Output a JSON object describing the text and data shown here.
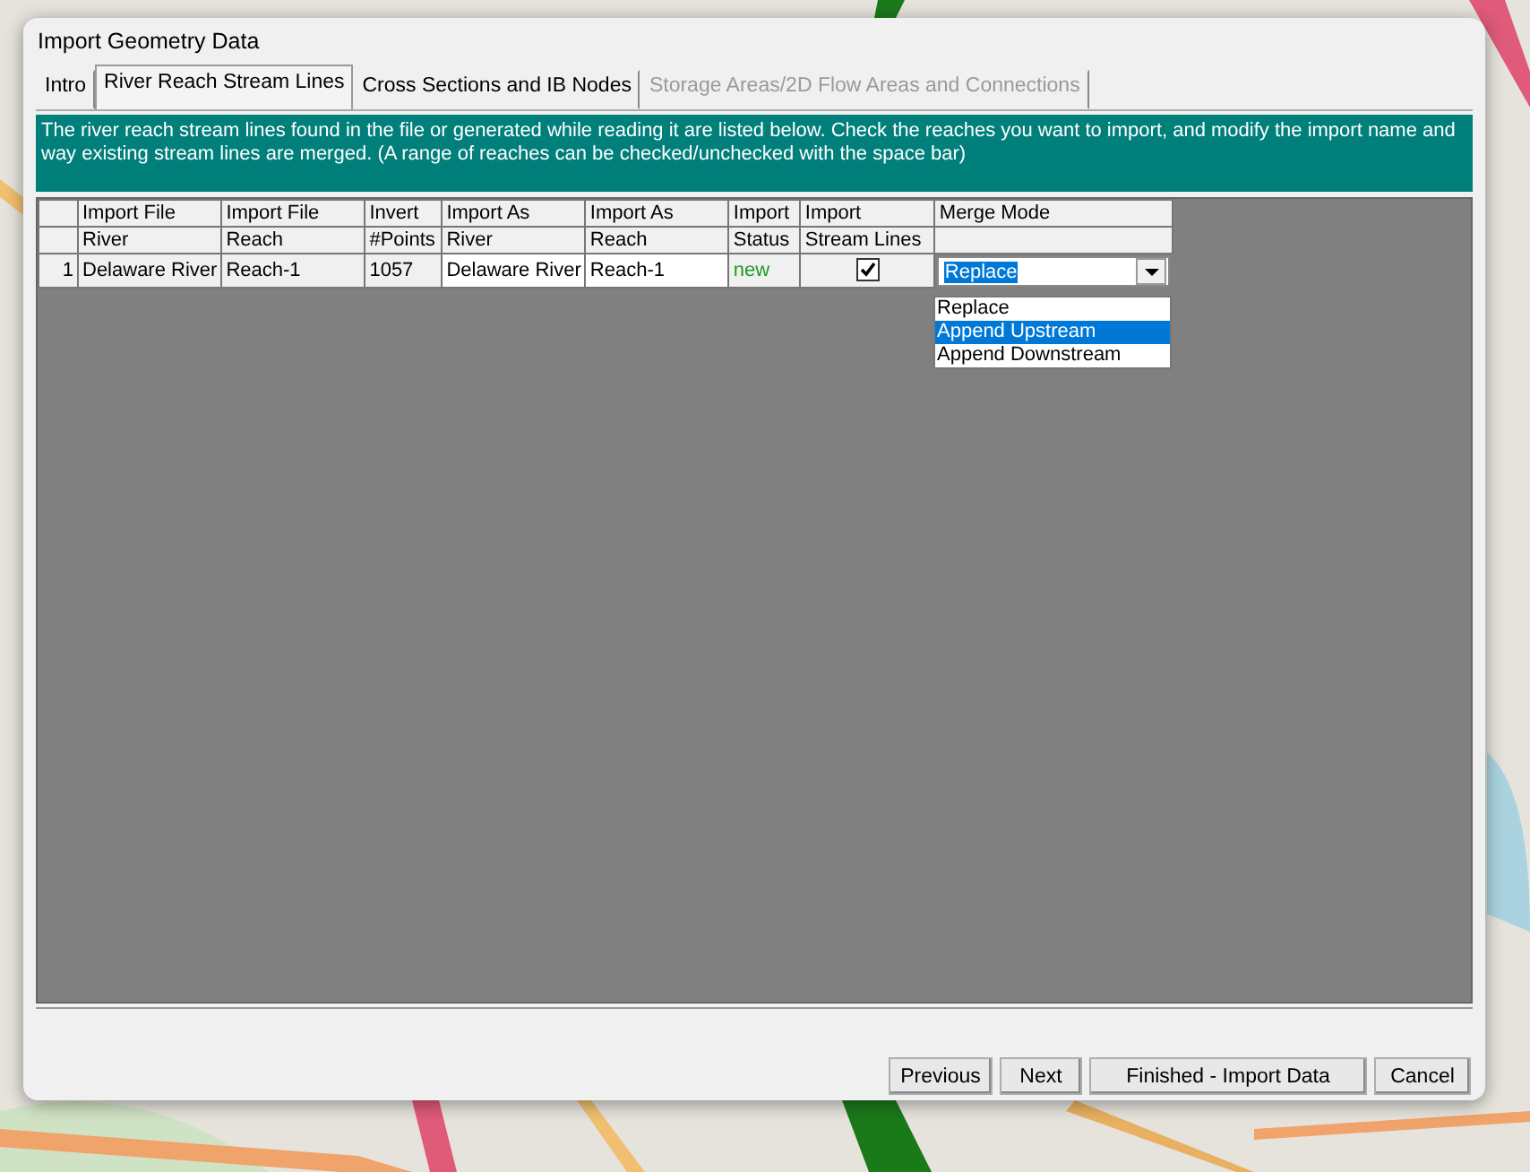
{
  "window": {
    "title": "Import Geometry Data"
  },
  "tabs": [
    {
      "label": "Intro",
      "selected": false,
      "disabled": false
    },
    {
      "label": "River Reach Stream Lines",
      "selected": true,
      "disabled": false
    },
    {
      "label": "Cross Sections and IB Nodes",
      "selected": false,
      "disabled": false
    },
    {
      "label": "Storage Areas/2D Flow Areas and Connections",
      "selected": false,
      "disabled": true
    }
  ],
  "instructions": "The river reach stream lines found in the file or generated while reading it are listed below.  Check the reaches you want to import, and modify the import name and way existing stream lines are merged.  (A range of reaches can be checked/unchecked with the space bar)",
  "table": {
    "columns": [
      {
        "line_1": "Import File",
        "line_2": "River"
      },
      {
        "line_1": "Import File",
        "line_2": "Reach"
      },
      {
        "line_1": "Invert",
        "line_2": "#Points"
      },
      {
        "line_1": "Import As",
        "line_2": "River"
      },
      {
        "line_1": "Import As",
        "line_2": "Reach"
      },
      {
        "line_1": "Import",
        "line_2": "Status"
      },
      {
        "line_1": "Import",
        "line_2": "Stream Lines"
      },
      {
        "line_1": "Merge Mode"
      }
    ],
    "rows": [
      {
        "number": "1",
        "cells": [
          "Delaware River",
          "Reach-1",
          "1057",
          "Delaware River",
          "Reach-1"
        ],
        "status": "new",
        "import_stream_lines": true,
        "merge_mode": "Replace"
      }
    ]
  },
  "dropdown": {
    "options": [
      {
        "label": "Replace",
        "selected": false
      },
      {
        "label": "Append Upstream",
        "selected": true
      },
      {
        "label": "Append Downstream",
        "selected": false
      }
    ]
  },
  "buttons": [
    "Previous",
    "Next",
    "Finished - Import Data",
    "Cancel"
  ]
}
